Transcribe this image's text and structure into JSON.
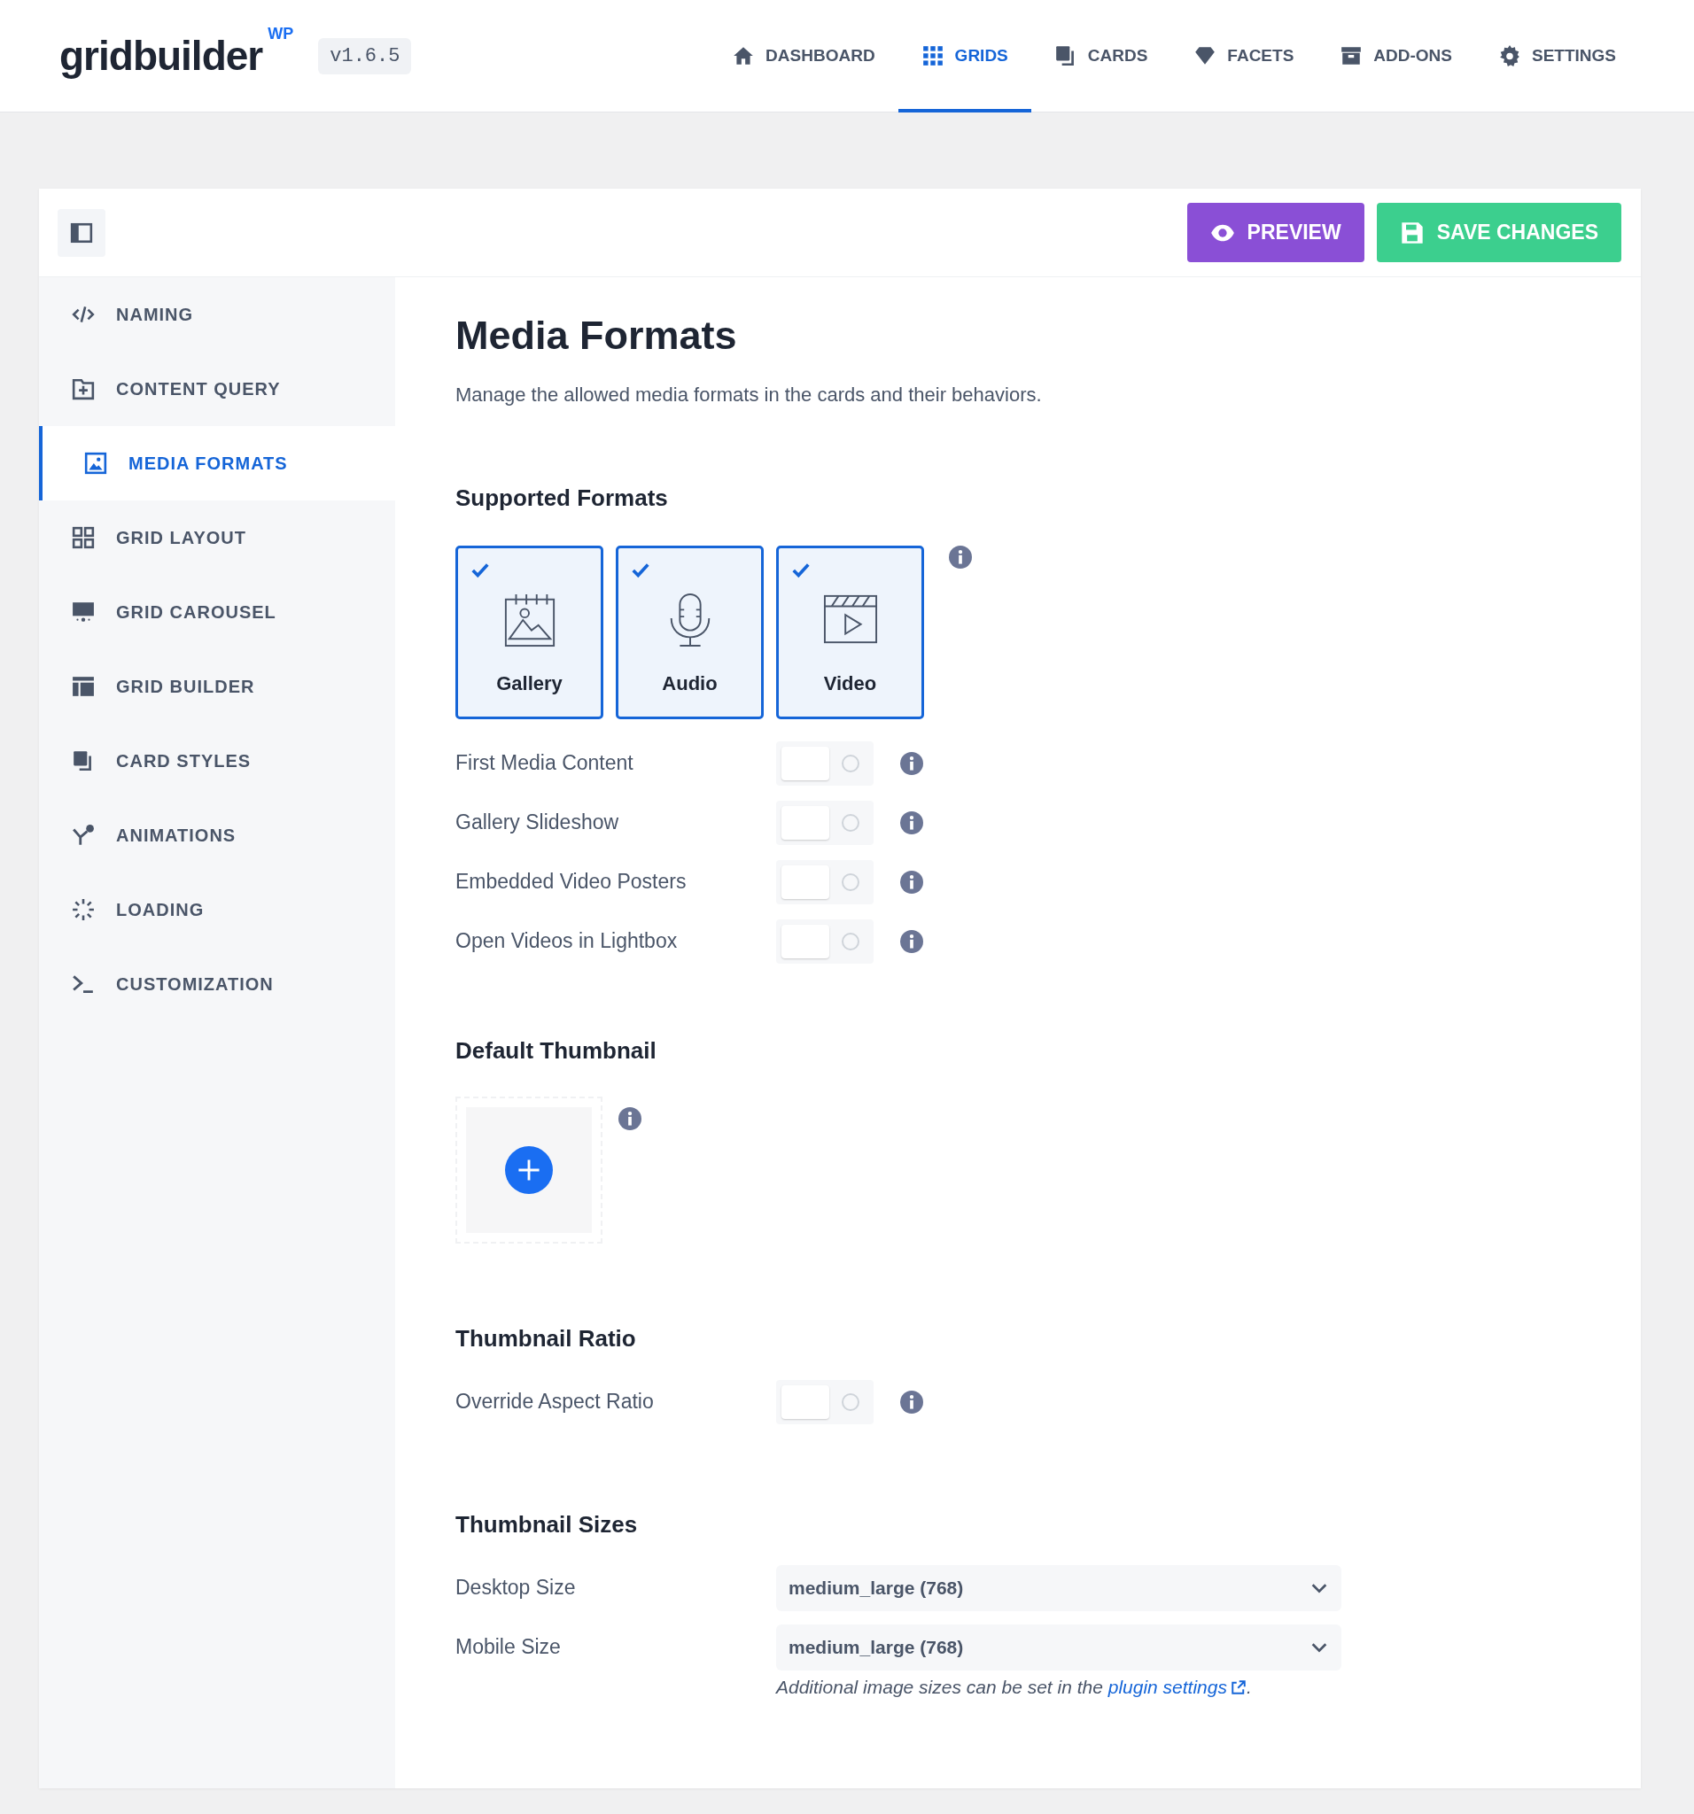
{
  "header": {
    "logo": "gridbuilder",
    "logo_suffix": "WP",
    "version": "v1.6.5",
    "nav": [
      {
        "label": "DASHBOARD",
        "selected": false
      },
      {
        "label": "GRIDS",
        "selected": true
      },
      {
        "label": "CARDS",
        "selected": false
      },
      {
        "label": "FACETS",
        "selected": false
      },
      {
        "label": "ADD-ONS",
        "selected": false
      },
      {
        "label": "SETTINGS",
        "selected": false
      }
    ]
  },
  "toolbar": {
    "buttons": [
      {
        "label": "PREVIEW",
        "kind": "preview"
      },
      {
        "label": "SAVE CHANGES",
        "kind": "save"
      }
    ]
  },
  "sidebar": {
    "items": [
      {
        "label": "NAMING",
        "selected": false
      },
      {
        "label": "CONTENT QUERY",
        "selected": false
      },
      {
        "label": "MEDIA FORMATS",
        "selected": true
      },
      {
        "label": "GRID LAYOUT",
        "selected": false
      },
      {
        "label": "GRID CAROUSEL",
        "selected": false
      },
      {
        "label": "GRID BUILDER",
        "selected": false
      },
      {
        "label": "CARD STYLES",
        "selected": false
      },
      {
        "label": "ANIMATIONS",
        "selected": false
      },
      {
        "label": "LOADING",
        "selected": false
      },
      {
        "label": "CUSTOMIZATION",
        "selected": false
      }
    ]
  },
  "content": {
    "title": "Media Formats",
    "description": "Manage the allowed media formats in the cards and their behaviors.",
    "supported_formats": {
      "heading": "Supported Formats",
      "formats": [
        {
          "label": "Gallery",
          "checked": true
        },
        {
          "label": "Audio",
          "checked": true
        },
        {
          "label": "Video",
          "checked": true
        }
      ],
      "toggles": [
        {
          "label": "First Media Content",
          "on": false
        },
        {
          "label": "Gallery Slideshow",
          "on": false
        },
        {
          "label": "Embedded Video Posters",
          "on": false
        },
        {
          "label": "Open Videos in Lightbox",
          "on": false
        }
      ]
    },
    "default_thumbnail": {
      "heading": "Default Thumbnail"
    },
    "thumbnail_ratio": {
      "heading": "Thumbnail Ratio",
      "toggles": [
        {
          "label": "Override Aspect Ratio",
          "on": false
        }
      ]
    },
    "thumbnail_sizes": {
      "heading": "Thumbnail Sizes",
      "selects": [
        {
          "label": "Desktop Size",
          "value": "medium_large (768)"
        },
        {
          "label": "Mobile Size",
          "value": "medium_large (768)"
        }
      ],
      "note": "Additional image sizes can be set in the",
      "note_link": "plugin settings",
      "note_end": "."
    }
  }
}
